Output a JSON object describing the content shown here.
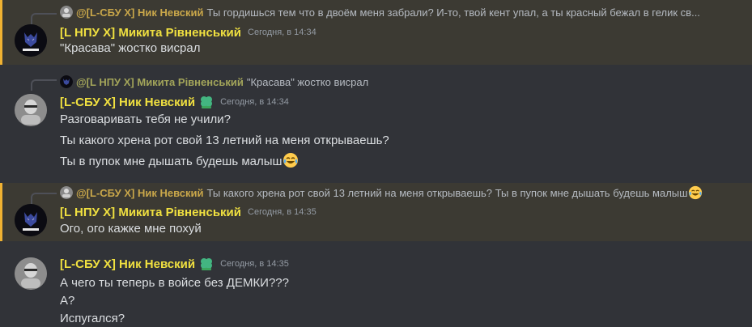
{
  "messages": [
    {
      "highlight": true,
      "reply": {
        "name": "@[L-СБУ X] Ник Невский",
        "text": "Ты гордишься тем что в двоём меня забрали?  И-то, твой кент упал, а ты красный бежал в гелик св..."
      },
      "author": "[L НПУ X] Микита Рівненський",
      "timestamp": "Сегодня, в 14:34",
      "lines": [
        "\"Красава\" жостко висрал"
      ]
    },
    {
      "highlight": false,
      "reply": {
        "name": "@[L НПУ X] Микита Рівненський",
        "text": "\"Красава\" жостко висрал"
      },
      "author": "[L-СБУ X] Ник Невский",
      "timestamp": "Сегодня, в 14:34",
      "lines": [
        "Разговаривать тебя не учили?",
        "Ты какого хрена рот свой 13 летний на меня открываешь?",
        "Ты в пупок мне дышать будешь малыш"
      ]
    },
    {
      "highlight": true,
      "reply": {
        "name": "@[L-СБУ X] Ник Невский",
        "text": "Ты какого хрена рот свой 13 летний на меня открываешь?  Ты в пупок мне дышать будешь малыш"
      },
      "author": "[L НПУ X] Микита Рівненський",
      "timestamp": "Сегодня, в 14:35",
      "lines": [
        "Ого, ого кажке мне похуй"
      ]
    },
    {
      "highlight": false,
      "author": "[L-СБУ X] Ник Невский",
      "timestamp": "Сегодня, в 14:35",
      "lines": [
        "А чего ты теперь в войсе без ДЕМКИ???",
        "А?",
        "Испугался?"
      ]
    }
  ],
  "icons": {
    "role_badge": "clover-badge-icon",
    "emoji": "joy-emoji-icon"
  },
  "colors": {
    "background": "#313338",
    "highlight_bg": "#3c3a33",
    "highlight_bar": "#f0b232",
    "username": "#f0e040",
    "timestamp": "#949ba4",
    "badge": "#43b581"
  }
}
